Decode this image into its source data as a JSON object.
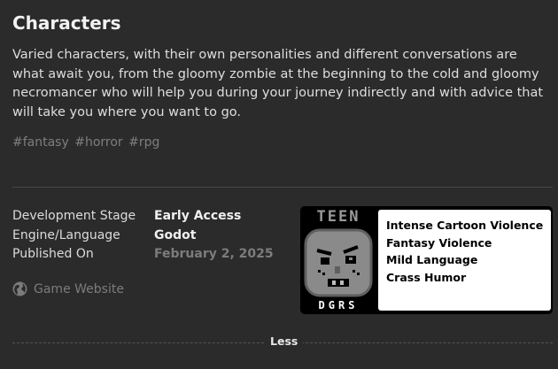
{
  "section": {
    "title": "Characters",
    "description": "Varied characters, with their own personalities and different conversations are what await you, from the gloomy zombie at the beginning to the cold and gloomy necromancer who will help you during your journey indirectly and with advice that will take you where you want to go."
  },
  "tags": [
    "#fantasy",
    "#horror",
    "#rpg"
  ],
  "info": [
    {
      "label": "Development Stage",
      "value": "Early Access"
    },
    {
      "label": "Engine/Language",
      "value": "Godot"
    },
    {
      "label": "Published On",
      "value": "February 2, 2025"
    }
  ],
  "website": {
    "label": "Game Website",
    "icon": "globe-icon"
  },
  "rating": {
    "badge_top": "TEEN",
    "badge_bottom": "DGRS",
    "descriptors": [
      "Intense Cartoon Violence",
      "Fantasy Violence",
      "Mild Language",
      "Crass Humor"
    ]
  },
  "toggle": {
    "label": "Less"
  },
  "colors": {
    "background": "#2b2b2b",
    "text": "#dcdcdc",
    "muted": "#7c7c7c"
  }
}
